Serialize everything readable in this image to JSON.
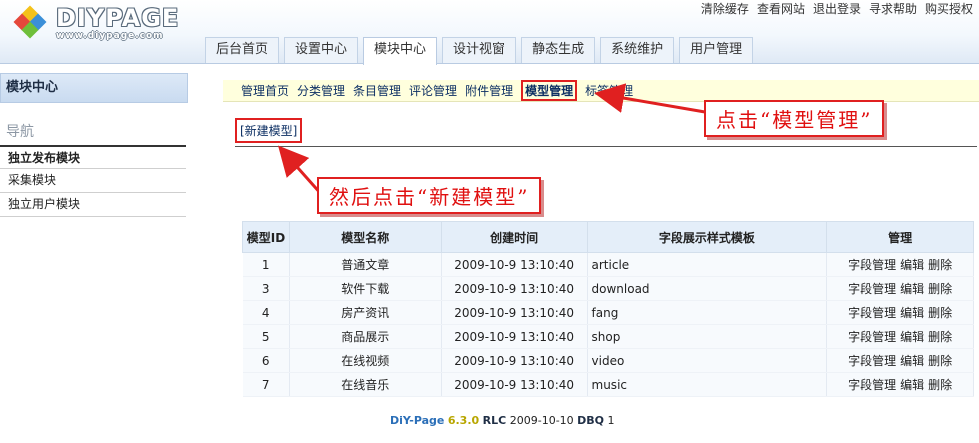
{
  "logo": {
    "brand": "DIYPAGE",
    "url": "www.diypage.com"
  },
  "top_links": [
    "清除缓存",
    "查看网站",
    "退出登录",
    "寻求帮助",
    "购买授权"
  ],
  "main_nav": [
    {
      "label": "后台首页",
      "active": false
    },
    {
      "label": "设置中心",
      "active": false
    },
    {
      "label": "模块中心",
      "active": true
    },
    {
      "label": "设计视窗",
      "active": false
    },
    {
      "label": "静态生成",
      "active": false
    },
    {
      "label": "系统维护",
      "active": false
    },
    {
      "label": "用户管理",
      "active": false
    }
  ],
  "sidebar": {
    "title": "模块中心",
    "nav_label": "导航",
    "items": [
      {
        "label": "独立发布模块",
        "active": true
      },
      {
        "label": "采集模块",
        "active": false
      },
      {
        "label": "独立用户模块",
        "active": false
      }
    ]
  },
  "sub_nav": [
    {
      "label": "管理首页",
      "active": false
    },
    {
      "label": "分类管理",
      "active": false
    },
    {
      "label": "条目管理",
      "active": false
    },
    {
      "label": "评论管理",
      "active": false
    },
    {
      "label": "附件管理",
      "active": false
    },
    {
      "label": "模型管理",
      "active": true
    },
    {
      "label": "标签管理",
      "active": false
    }
  ],
  "new_model_button": "[新建模型]",
  "callouts": {
    "click_model_manage": "点击“模型管理”",
    "then_click_new_model": "然后点击“新建模型”"
  },
  "table": {
    "headers": [
      "模型ID",
      "模型名称",
      "创建时间",
      "字段展示样式模板",
      "管理"
    ],
    "rows": [
      {
        "id": "1",
        "name": "普通文章",
        "created": "2009-10-9 13:10:40",
        "template": "article"
      },
      {
        "id": "3",
        "name": "软件下载",
        "created": "2009-10-9 13:10:40",
        "template": "download"
      },
      {
        "id": "4",
        "name": "房产资讯",
        "created": "2009-10-9 13:10:40",
        "template": "fang"
      },
      {
        "id": "5",
        "name": "商品展示",
        "created": "2009-10-9 13:10:40",
        "template": "shop"
      },
      {
        "id": "6",
        "name": "在线视频",
        "created": "2009-10-9 13:10:40",
        "template": "video"
      },
      {
        "id": "7",
        "name": "在线音乐",
        "created": "2009-10-9 13:10:40",
        "template": "music"
      }
    ],
    "actions": [
      "字段管理",
      "编辑",
      "删除"
    ]
  },
  "footer": {
    "brand": "DiY-Page",
    "version": "6.3.0",
    "rlc_label": "RLC",
    "rlc_date": "2009-10-10",
    "dbq_label": "DBQ",
    "dbq_value": "1"
  },
  "colors": {
    "callout_red": "#e02020",
    "table_header_bg": "#e4eef9",
    "subnav_bg": "#ffffdd",
    "sidebar_title_bg": "#c9dbf0"
  }
}
